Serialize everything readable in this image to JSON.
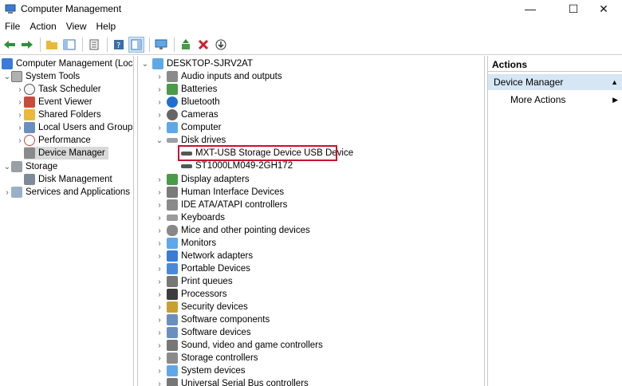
{
  "window": {
    "title": "Computer Management",
    "minimize": "—",
    "maximize": "☐",
    "close": "✕"
  },
  "menu": [
    "File",
    "Action",
    "View",
    "Help"
  ],
  "left_tree": {
    "root": "Computer Management (Local",
    "system_tools": "System Tools",
    "items": [
      "Task Scheduler",
      "Event Viewer",
      "Shared Folders",
      "Local Users and Groups",
      "Performance",
      "Device Manager"
    ],
    "storage": "Storage",
    "disk_management": "Disk Management",
    "services": "Services and Applications"
  },
  "device_tree": {
    "root": "DESKTOP-SJRV2AT",
    "categories_top": [
      "Audio inputs and outputs",
      "Batteries",
      "Bluetooth",
      "Cameras",
      "Computer"
    ],
    "disk_drives": "Disk drives",
    "disk_children": [
      "MXT-USB Storage Device USB Device",
      "ST1000LM049-2GH172"
    ],
    "categories_bottom": [
      "Display adapters",
      "Human Interface Devices",
      "IDE ATA/ATAPI controllers",
      "Keyboards",
      "Mice and other pointing devices",
      "Monitors",
      "Network adapters",
      "Portable Devices",
      "Print queues",
      "Processors",
      "Security devices",
      "Software components",
      "Software devices",
      "Sound, video and game controllers",
      "Storage controllers",
      "System devices",
      "Universal Serial Bus controllers"
    ]
  },
  "actions": {
    "header": "Actions",
    "section": "Device Manager",
    "more": "More Actions"
  },
  "colors": {
    "highlight_border": "#c8102e",
    "selected_bg": "#d9d9d9",
    "actions_section_bg": "#d6e6f5"
  }
}
